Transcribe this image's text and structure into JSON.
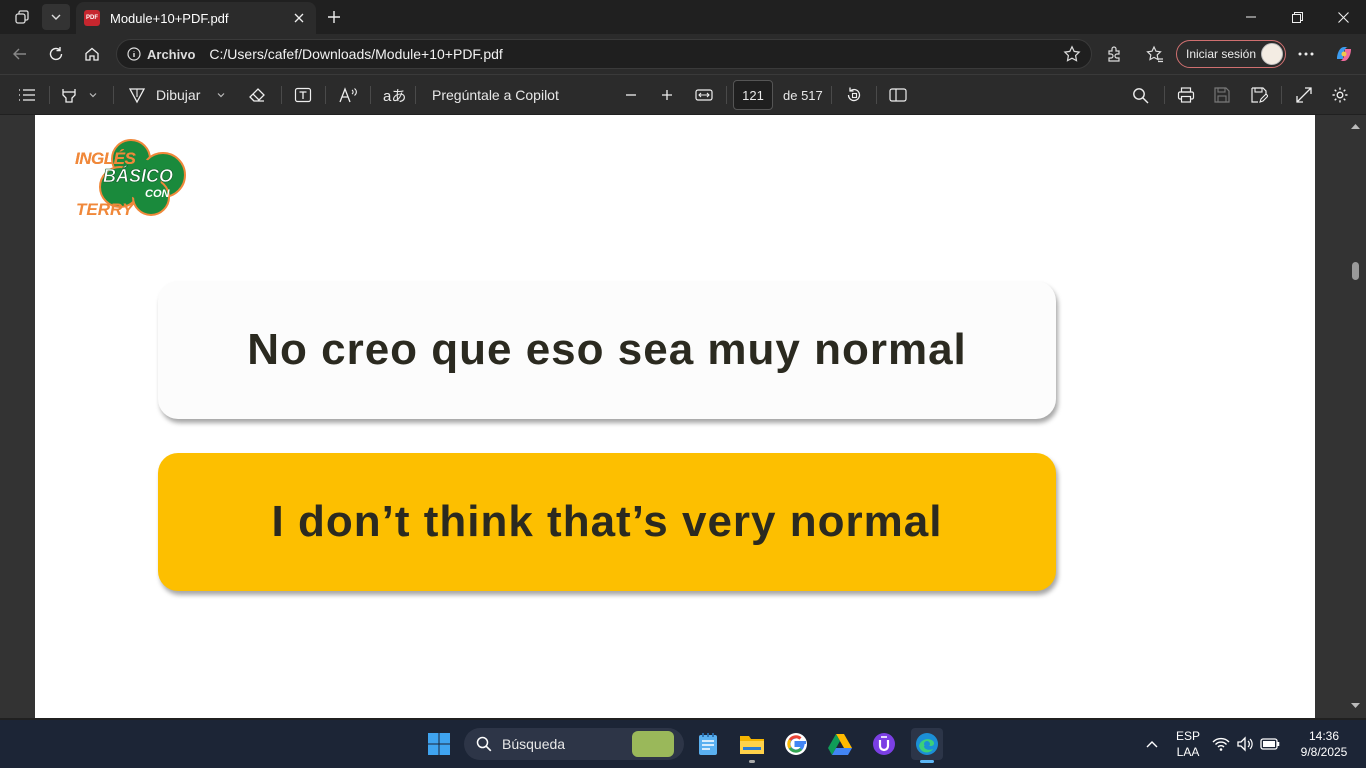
{
  "browser": {
    "tab_title": "Module+10+PDF.pdf",
    "tab_favicon_text": "PDF",
    "url_scheme_label": "Archivo",
    "url": "C:/Users/cafef/Downloads/Module+10+PDF.pdf",
    "signin_label": "Iniciar sesión"
  },
  "pdf_toolbar": {
    "draw_label": "Dibujar",
    "copilot_label": "Pregúntale a Copilot",
    "page_current": "121",
    "page_total_label": "de 517"
  },
  "document": {
    "logo": {
      "line1": "INGLÉS",
      "line2": "BÁSICO",
      "line3": "CON",
      "line4": "TERRY"
    },
    "spanish_phrase": "No creo que eso sea muy normal",
    "english_phrase": "I don’t think that’s very normal"
  },
  "taskbar": {
    "search_placeholder": "Búsqueda",
    "language": "ESP",
    "layout": "LAA",
    "time": "14:36",
    "date": "9/8/2025"
  },
  "colors": {
    "accent_yellow": "#fdbf00",
    "logo_green": "#1a8a3c",
    "logo_orange": "#f0883a",
    "signin_border": "#d07070"
  }
}
